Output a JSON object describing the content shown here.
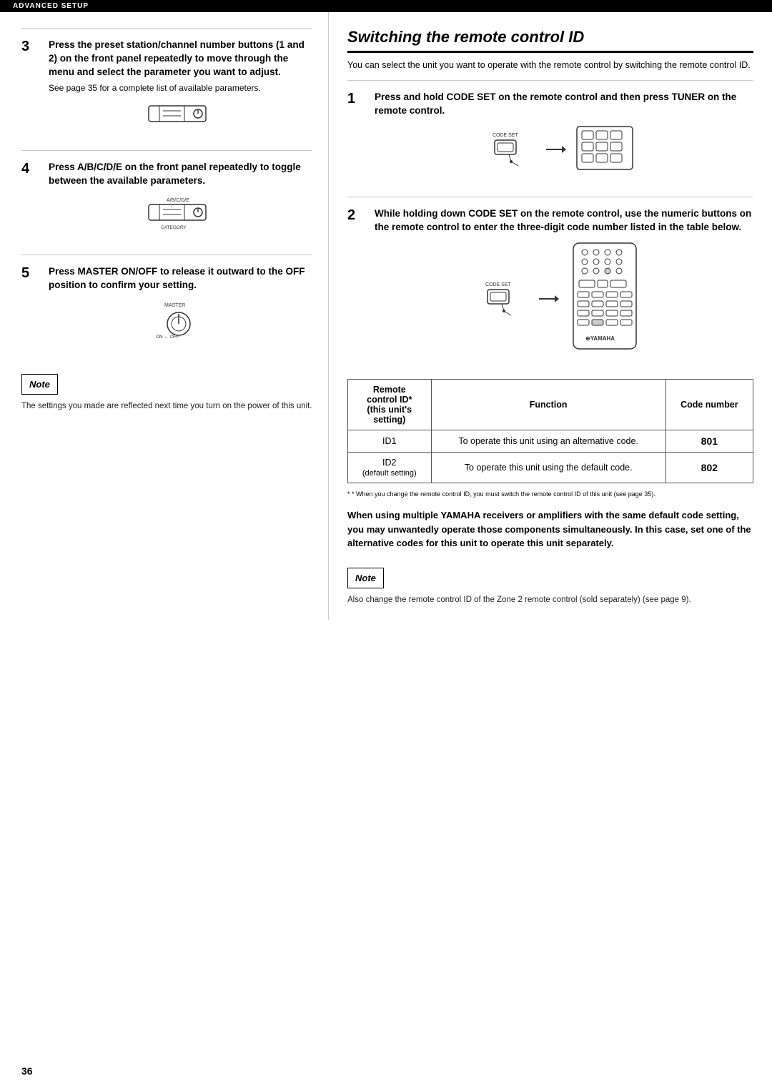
{
  "topBar": {
    "label": "ADVANCED SETUP"
  },
  "leftCol": {
    "steps": [
      {
        "num": "3",
        "title": "Press the preset station/channel number buttons (1 and 2) on the front panel repeatedly to move through the menu and select the parameter you want to adjust.",
        "subtitle": "See page 35 for a complete list of available parameters."
      },
      {
        "num": "4",
        "title": "Press A/B/C/D/E on the front panel repeatedly to toggle between the available parameters."
      },
      {
        "num": "5",
        "title": "Press MASTER ON/OFF to release it outward to the OFF position to confirm your setting."
      }
    ],
    "note": {
      "label": "Note",
      "text": "The settings you made are reflected next time you turn on the power of this unit."
    }
  },
  "rightCol": {
    "title": "Switching the remote control ID",
    "intro": "You can select the unit you want to operate with the remote control by switching the remote control ID.",
    "steps": [
      {
        "num": "1",
        "title": "Press and hold CODE SET on the remote control and then press TUNER on the remote control."
      },
      {
        "num": "2",
        "title": "While holding down CODE SET on the remote control, use the numeric buttons on the remote control to enter the three-digit code number listed in the table below."
      }
    ],
    "table": {
      "headers": [
        "Remote control ID*\n(this unit's setting)",
        "Function",
        "Code number"
      ],
      "rows": [
        {
          "id": "ID1",
          "function": "To operate this unit using an alternative code.",
          "code": "801"
        },
        {
          "id": "ID2\n(default setting)",
          "function": "To operate this unit using the default code.",
          "code": "802"
        }
      ]
    },
    "footnote": "* When you change the remote control ID, you must switch the remote control ID of this unit (see page 35).",
    "boldPara": "When using multiple YAMAHA receivers or amplifiers with the same default code setting, you may unwantedly operate those components simultaneously. In this case, set one of the alternative codes for this unit to operate this unit separately.",
    "note": {
      "label": "Note",
      "text": "Also change the remote control ID of the Zone 2 remote control (sold separately) (see page 9)."
    }
  },
  "pageNumber": "36"
}
